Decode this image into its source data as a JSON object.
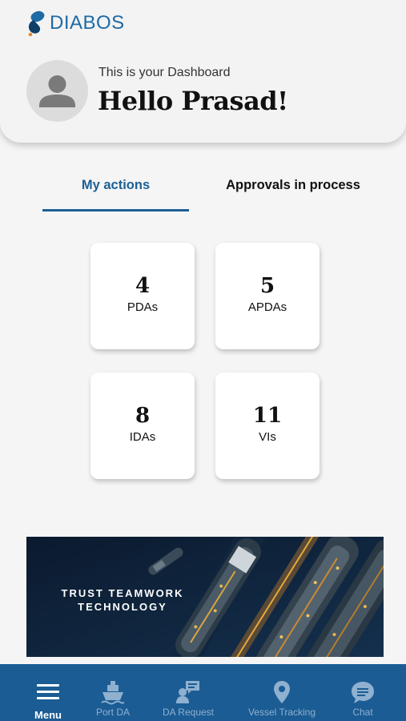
{
  "colors": {
    "brand": "#1d6aa5",
    "accent": "#1d5f94",
    "nav_background": "#1b5c94",
    "nav_inactive": "#8fb0cf"
  },
  "header": {
    "logo_text": "DIABOS",
    "logo_icon": "diabos-wave-logo",
    "avatar_icon": "user-placeholder-icon",
    "subtitle": "This is your Dashboard",
    "greeting": "Hello Prasad!"
  },
  "tabs": [
    {
      "label": "My actions",
      "active": true
    },
    {
      "label": "Approvals in process",
      "active": false
    }
  ],
  "cards": [
    {
      "count": "4",
      "label": "PDAs"
    },
    {
      "count": "5",
      "label": "APDAs"
    },
    {
      "count": "8",
      "label": "IDAs"
    },
    {
      "count": "11",
      "label": "VIs"
    }
  ],
  "banner": {
    "line1": "TRUST TEAMWORK",
    "line2": "TECHNOLOGY"
  },
  "nav": [
    {
      "label": "Menu",
      "icon": "menu-icon",
      "active": true
    },
    {
      "label": "Port DA",
      "icon": "ship-icon",
      "active": false
    },
    {
      "label": "DA Request",
      "icon": "chat-person-icon",
      "active": false
    },
    {
      "label": "Vessel Tracking",
      "icon": "location-pin-icon",
      "active": false
    },
    {
      "label": "Chat",
      "icon": "chat-bubble-icon",
      "active": false
    }
  ]
}
